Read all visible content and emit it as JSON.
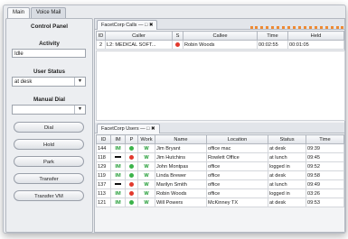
{
  "tabs": [
    "Main",
    "Voice Mail"
  ],
  "control_panel": {
    "title": "Control Panel",
    "activity_label": "Activity",
    "activity_value": "Idle",
    "user_status_label": "User Status",
    "user_status_value": "at desk",
    "manual_dial_label": "Manual Dial",
    "manual_dial_value": "",
    "buttons": [
      "Dial",
      "Hold",
      "Park",
      "Transfer",
      "Transfer VM"
    ]
  },
  "calls_panel": {
    "tab_label": "FacetCorp Calls",
    "tab_controls": "— □ ✖",
    "columns": [
      "ID",
      "Caller",
      "S",
      "Callee",
      "Time",
      "Held"
    ],
    "rows": [
      {
        "id": "2",
        "caller": "L2: MEDICAL SOFT...",
        "status": "red",
        "callee": "Robin Woods",
        "time": "00:02:55",
        "held": "00:01:05"
      }
    ]
  },
  "users_panel": {
    "tab_label": "FacetCorp Users",
    "tab_controls": "— □ ✖",
    "columns": [
      "ID",
      "IM",
      "P",
      "Work",
      "Name",
      "Location",
      "Status",
      "Time"
    ],
    "rows": [
      {
        "id": "144",
        "im": "IM",
        "p": "green",
        "work": "W",
        "name": "Jim Bryant",
        "location": "office mac",
        "status": "at desk",
        "time": "09:39"
      },
      {
        "id": "118",
        "im": "dash",
        "p": "red",
        "work": "W",
        "name": "Jim Hutchins",
        "location": "Rowlett Office",
        "status": "at lunch",
        "time": "09:45"
      },
      {
        "id": "129",
        "im": "IM",
        "p": "green",
        "work": "W",
        "name": "John Montpas",
        "location": "office",
        "status": "logged in",
        "time": "09:52"
      },
      {
        "id": "119",
        "im": "IM",
        "p": "green",
        "work": "W",
        "name": "Linda Brewer",
        "location": "office",
        "status": "at desk",
        "time": "09:58"
      },
      {
        "id": "137",
        "im": "dash",
        "p": "red",
        "work": "W",
        "name": "Marilyn Smith",
        "location": "office",
        "status": "at lunch",
        "time": "09:49"
      },
      {
        "id": "113",
        "im": "IM",
        "p": "red",
        "work": "W",
        "name": "Robin Woods",
        "location": "office",
        "status": "logged in",
        "time": "03:26"
      },
      {
        "id": "121",
        "im": "IM",
        "p": "green",
        "work": "W",
        "name": "Will Powers",
        "location": "McKinney TX",
        "status": "at desk",
        "time": "09:53"
      }
    ]
  }
}
